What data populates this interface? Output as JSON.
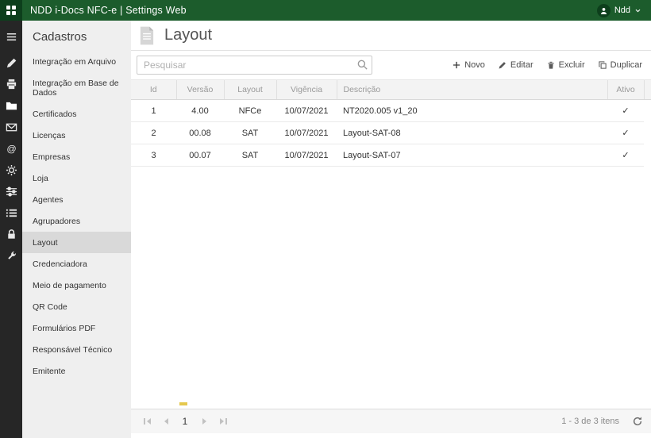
{
  "topbar": {
    "title": "NDD i-Docs NFC-e | Settings Web",
    "user_name": "Ndd"
  },
  "rail": {
    "items": [
      {
        "icon": "menu"
      },
      {
        "icon": "pen"
      },
      {
        "icon": "printer"
      },
      {
        "icon": "folder",
        "active": true
      },
      {
        "icon": "mail"
      },
      {
        "icon": "at"
      },
      {
        "icon": "gear"
      },
      {
        "icon": "sliders"
      },
      {
        "icon": "list"
      },
      {
        "icon": "lock"
      },
      {
        "icon": "wrench"
      }
    ]
  },
  "sidebar": {
    "header": "Cadastros",
    "items": [
      {
        "id": "integracao-arquivo",
        "label": "Integração em Arquivo"
      },
      {
        "id": "integracao-base-dados",
        "label": "Integração em Base de Dados"
      },
      {
        "id": "certificados",
        "label": "Certificados"
      },
      {
        "id": "licencas",
        "label": "Licenças"
      },
      {
        "id": "empresas",
        "label": "Empresas"
      },
      {
        "id": "loja",
        "label": "Loja"
      },
      {
        "id": "agentes",
        "label": "Agentes"
      },
      {
        "id": "agrupadores",
        "label": "Agrupadores"
      },
      {
        "id": "layout",
        "label": "Layout",
        "active": true
      },
      {
        "id": "credenciadora",
        "label": "Credenciadora"
      },
      {
        "id": "meio-de-pagamento",
        "label": "Meio de pagamento"
      },
      {
        "id": "qr-code",
        "label": "QR Code"
      },
      {
        "id": "formularios-pdf",
        "label": "Formulários PDF"
      },
      {
        "id": "responsavel-tecnico",
        "label": "Responsável Técnico"
      },
      {
        "id": "emitente",
        "label": "Emitente"
      }
    ]
  },
  "main": {
    "title": "Layout",
    "search_placeholder": "Pesquisar",
    "actions": [
      {
        "id": "novo",
        "label": "Novo",
        "icon": "plus"
      },
      {
        "id": "editar",
        "label": "Editar",
        "icon": "pencil"
      },
      {
        "id": "excluir",
        "label": "Excluir",
        "icon": "trash"
      },
      {
        "id": "duplicar",
        "label": "Duplicar",
        "icon": "duplicate"
      }
    ],
    "table": {
      "columns": [
        {
          "key": "id",
          "label": "Id"
        },
        {
          "key": "versao",
          "label": "Versão"
        },
        {
          "key": "layout",
          "label": "Layout"
        },
        {
          "key": "vigencia",
          "label": "Vigência"
        },
        {
          "key": "descricao",
          "label": "Descrição"
        },
        {
          "key": "ativo",
          "label": "Ativo"
        }
      ],
      "rows": [
        {
          "id": "1",
          "versao": "4.00",
          "layout": "NFCe",
          "vigencia": "10/07/2021",
          "descricao": "NT2020.005 v1_20",
          "ativo": true
        },
        {
          "id": "2",
          "versao": "00.08",
          "layout": "SAT",
          "vigencia": "10/07/2021",
          "descricao": "Layout-SAT-08",
          "ativo": true
        },
        {
          "id": "3",
          "versao": "00.07",
          "layout": "SAT",
          "vigencia": "10/07/2021",
          "descricao": "Layout-SAT-07",
          "ativo": true
        }
      ],
      "check_glyph": "✓"
    },
    "pager": {
      "page": "1",
      "info": "1 - 3 de 3 itens"
    }
  },
  "colors": {
    "brand_green": "#1c5c2c",
    "brand_green_dark": "#0d3f1c",
    "sidebar_bg": "#efefef",
    "active_item_bg": "#d9d9d9",
    "accent_mark": "#e5c84e"
  }
}
